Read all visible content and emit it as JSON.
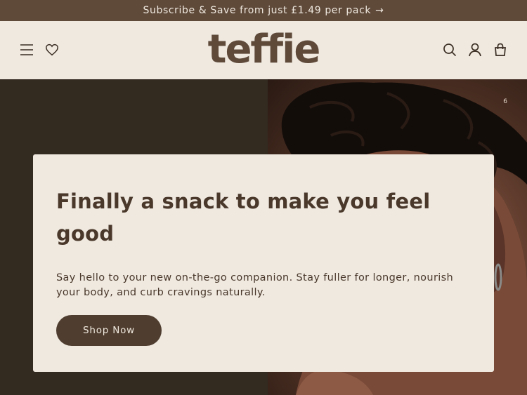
{
  "announcement": {
    "text": "Subscribe & Save from just £1.49 per pack",
    "arrow": "→"
  },
  "header": {
    "logo": "teffie",
    "left_icons": [
      "menu-icon",
      "heart-icon"
    ],
    "right_icons": [
      "search-icon",
      "account-icon",
      "bag-icon"
    ]
  },
  "hero": {
    "slide_indicator": "6",
    "headline": "Finally a snack to make you feel good",
    "body": "Say hello to your new on-the-go companion. Stay fuller for longer, nourish your body, and curb cravings naturally.",
    "button_label": "Shop Now"
  },
  "colors": {
    "announcement_bg": "#5f4a3a",
    "header_bg": "#efe9e0",
    "brand_brown": "#5f4a3a",
    "hero_left_bg": "#332a20",
    "button_bg": "#4f3d2f"
  }
}
